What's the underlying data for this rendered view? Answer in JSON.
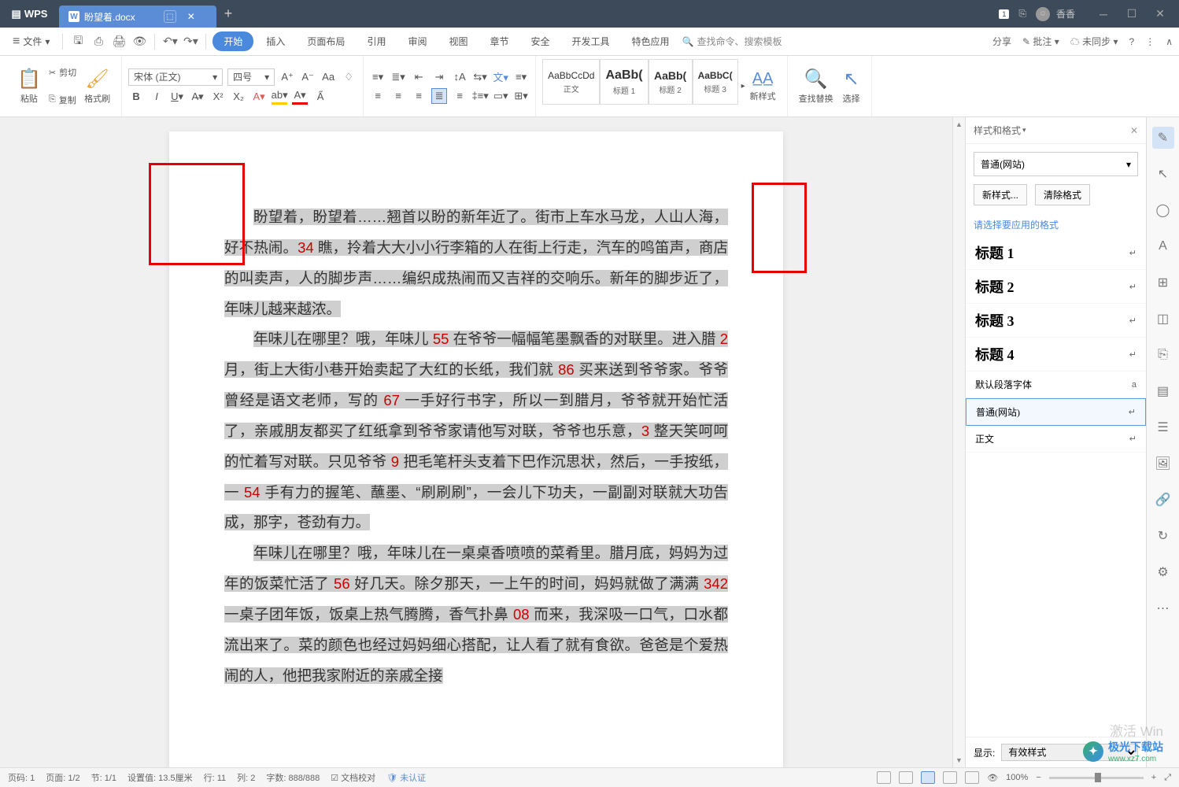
{
  "titlebar": {
    "app": "WPS",
    "tab_title": "盼望着.docx",
    "badge": "1",
    "username": "香香"
  },
  "menu": {
    "file": "文件",
    "tabs": [
      "开始",
      "插入",
      "页面布局",
      "引用",
      "审阅",
      "视图",
      "章节",
      "安全",
      "开发工具",
      "特色应用"
    ],
    "active": 0,
    "search": "查找命令、搜索模板",
    "right": {
      "share": "分享",
      "comment": "批注",
      "sync": "未同步"
    }
  },
  "ribbon": {
    "paste": "粘贴",
    "cut": "剪切",
    "copy": "复制",
    "format_painter": "格式刷",
    "font_name": "宋体 (正文)",
    "font_size": "四号",
    "styles": [
      {
        "preview": "AaBbCcDd",
        "label": "正文"
      },
      {
        "preview": "AaBb(",
        "label": "标题 1"
      },
      {
        "preview": "AaBb(",
        "label": "标题 2"
      },
      {
        "preview": "AaBbC(",
        "label": "标题 3"
      }
    ],
    "new_style": "新样式",
    "find_replace": "查找替换",
    "select": "选择"
  },
  "style_panel": {
    "title": "样式和格式",
    "current": "普通(网站)",
    "new_style": "新样式...",
    "clear": "清除格式",
    "prompt": "请选择要应用的格式",
    "items": [
      {
        "name": "标题 1",
        "h": true,
        "mark": "↵"
      },
      {
        "name": "标题 2",
        "h": true,
        "mark": "↵"
      },
      {
        "name": "标题 3",
        "h": true,
        "mark": "↵"
      },
      {
        "name": "标题 4",
        "h": true,
        "mark": "↵"
      },
      {
        "name": "默认段落字体",
        "h": false,
        "mark": "a"
      },
      {
        "name": "普通(网站)",
        "h": false,
        "mark": "↵",
        "selected": true
      },
      {
        "name": "正文",
        "h": false,
        "mark": "↵"
      }
    ],
    "display_label": "显示:",
    "display_value": "有效样式"
  },
  "doc": {
    "p1a": "盼望着，盼望着……翘首以盼的新年近了。街市上车水马龙，人山人海，好不热闹。",
    "p1_red1": "34",
    "p1b": " 瞧，拎着大大小小行李箱的人在街上行走，汽车的鸣笛声，商店的叫卖声，人的脚步声……编织成热闹而又吉祥的交响乐。新年的脚步近了，年味儿越来越浓。",
    "p2a": "年味儿在哪里？哦，年味儿 ",
    "p2_r1": "55",
    "p2b": " 在爷爷一幅幅笔墨飘香的对联里。进入腊 ",
    "p2_r2": "2",
    "p2c": " 月，街上大街小巷开始卖起了大红的长纸，我们就 ",
    "p2_r3": "86",
    "p2d": " 买来送到爷爷家。爷爷曾经是语文老师，写的 ",
    "p2_r4": "67",
    "p2e": " 一手好行书字，所以一到腊月，爷爷就开始忙活了，亲戚朋友都买了红纸拿到爷爷家请他写对联，爷爷也乐意，",
    "p2_r5": "3",
    "p2f": " 整天笑呵呵的忙着写对联。只见爷爷 ",
    "p2_r6": "9",
    "p2g": " 把毛笔杆头支着下巴作沉思状，然后，一手按纸，一 ",
    "p2_r7": "54",
    "p2h": " 手有力的握笔、蘸墨、“刷刷刷”，一会儿下功夫，一副副对联就大功告成，那字，苍劲有力。",
    "p3a": "年味儿在哪里？哦，年味儿在一桌桌香喷喷的菜肴里。腊月底，妈妈为过年的饭菜忙活了 ",
    "p3_r1": "56",
    "p3b": " 好几天。除夕那天，一上午的时间，妈妈就做了满满 ",
    "p3_r2": "342",
    "p3c": " 一桌子团年饭，饭桌上热气腾腾，香气扑鼻 ",
    "p3_r3": "08",
    "p3d": " 而来，我深吸一口气，口水都流出来了。菜的颜色也经过妈妈细心搭配，让人看了就有食欲。爸爸是个爱热闹的人，他把我家附近的亲戚全接"
  },
  "status": {
    "page_no": "页码: 1",
    "page": "页面: 1/2",
    "section": "节: 1/1",
    "setting": "设置值: 13.5厘米",
    "line": "行: 11",
    "col": "列: 2",
    "words": "字数: 888/888",
    "spell": "文档校对",
    "auth": "未认证",
    "zoom": "100%"
  },
  "activate": "激活 Win",
  "watermark": {
    "site": "极光下载站",
    "url": "www.xz7.com"
  }
}
